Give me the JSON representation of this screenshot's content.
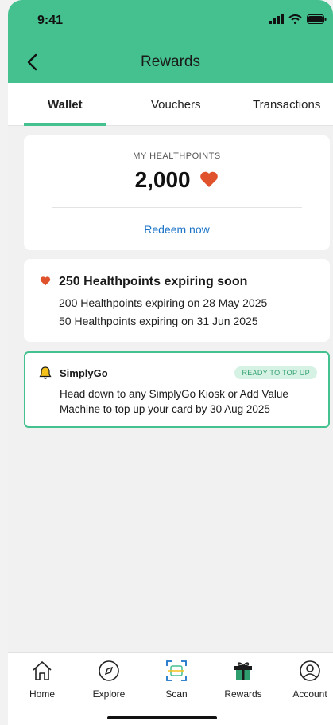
{
  "status_bar": {
    "time": "9:41"
  },
  "header": {
    "title": "Rewards",
    "back_icon": "chevron-left-icon"
  },
  "tabs": [
    {
      "label": "Wallet",
      "active": true
    },
    {
      "label": "Vouchers",
      "active": false
    },
    {
      "label": "Transactions",
      "active": false
    }
  ],
  "healthpoints": {
    "label": "MY HEALTHPOINTS",
    "value": "2,000",
    "redeem_label": "Redeem now"
  },
  "expiring": {
    "title": "250 Healthpoints expiring soon",
    "lines": [
      "200 Healthpoints expiring on 28 May 2025",
      "50 Healthpoints expiring on 31 Jun 2025"
    ]
  },
  "simplygo": {
    "title": "SimplyGo",
    "badge": "READY TO TOP UP",
    "text": "Head down to any SimplyGo Kiosk or Add Value Machine to top up your card by 30 Aug 2025"
  },
  "bottom_nav": [
    {
      "label": "Home",
      "icon": "home-icon"
    },
    {
      "label": "Explore",
      "icon": "compass-icon"
    },
    {
      "label": "Scan",
      "icon": "scan-icon"
    },
    {
      "label": "Rewards",
      "icon": "gift-icon"
    },
    {
      "label": "Account",
      "icon": "account-icon"
    }
  ],
  "colors": {
    "accent": "#44c18f",
    "heart": "#e0522b",
    "link": "#1b73c7",
    "badge_bg": "#d6f2e4"
  }
}
